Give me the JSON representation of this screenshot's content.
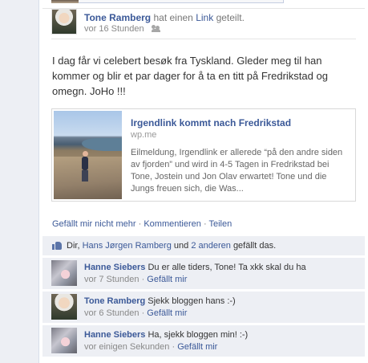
{
  "post": {
    "author": "Tone Ramberg",
    "action_prefix": "hat einen",
    "action_link": "Link",
    "action_suffix": "geteilt.",
    "timestamp": "vor 16 Stunden",
    "audience_icon": "friends-icon",
    "message": "I dag får vi celebert besøk fra Tyskland. Gleder meg til han kommer og blir et par dager for å ta en titt på Fredrikstad og omegn. JoHo !!!"
  },
  "shared_link": {
    "title": "Irgendlink kommt nach Fredrikstad",
    "domain": "wp.me",
    "description": "Eilmeldung, Irgendlink er allerede “på den andre siden av fjorden” und wird in 4-5 Tagen in Fredrikstad bei Tone, Jostein und Jon Olav erwartet! Tone und die Jungs freuen sich, die Was..."
  },
  "actions": {
    "unlike": "Gefällt mir nicht mehr",
    "separator": "·",
    "comment": "Kommentieren",
    "share": "Teilen"
  },
  "likes": {
    "icon": "like-icon",
    "prefix": "Dir,",
    "person": "Hans Jørgen Ramberg",
    "middle": "und",
    "others": "2 anderen",
    "suffix": "gefällt das."
  },
  "comments": [
    {
      "author": "Hanne Siebers",
      "text": "Du er alle tiders, Tone! Ta xkk skal du ha",
      "time": "vor 7 Stunden",
      "like": "Gefällt mir"
    },
    {
      "author": "Tone Ramberg",
      "text": "Sjekk bloggen hans :-)",
      "time": "vor 6 Stunden",
      "like": "Gefällt mir"
    },
    {
      "author": "Hanne Siebers",
      "text": "Ha, sjekk bloggen min! :-)",
      "time": "vor einigen Sekunden",
      "like": "Gefällt mir"
    }
  ],
  "colors": {
    "link": "#3b5998",
    "ufi_background": "#edeff4",
    "muted_text": "#888888"
  }
}
